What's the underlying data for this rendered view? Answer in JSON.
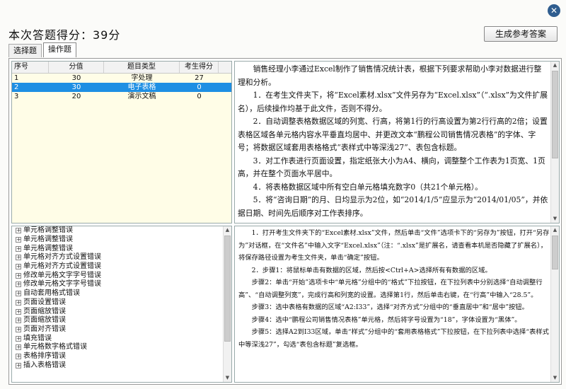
{
  "window": {
    "close_icon": "close-icon",
    "close_glyph": "✕"
  },
  "header": {
    "score_text": "本次答题得分：39分",
    "generate_button": "生成参考答案"
  },
  "tabs": [
    {
      "label": "选择题",
      "active": false
    },
    {
      "label": "操作题",
      "active": true
    }
  ],
  "table": {
    "columns": [
      "序号",
      "分值",
      "题目类型",
      "考生得分"
    ],
    "rows": [
      {
        "num": "1",
        "score": "30",
        "type": "字处理",
        "got": "27",
        "selected": false
      },
      {
        "num": "2",
        "score": "30",
        "type": "电子表格",
        "got": "0",
        "selected": true
      },
      {
        "num": "3",
        "score": "20",
        "type": "演示文稿",
        "got": "0",
        "selected": false
      }
    ]
  },
  "question": {
    "paragraphs": [
      "销售经理小李通过Excel制作了销售情况统计表，根据下列要求帮助小李对数据进行整理和分析。",
      "1．在考生文件夹下，将“Excel素材.xlsx”文件另存为“Excel.xlsx”（“.xlsx”为文件扩展名），后续操作均基于此文件，否则不得分。",
      "2．自动调整表格数据区域的列宽、行高，将第1行的行高设置为第2行行高的2倍；设置表格区域各单元格内容水平垂直均居中、并更改文本“鹏程公司销售情况表格”的字体、字号；将数据区域套用表格格式“表样式中等深浅27”、表包含标题。",
      "3．对工作表进行页面设置，指定纸张大小为A4、横向，调整整个工作表为1页宽、1页高，并在整个页面水平居中。",
      "4．将表格数据区域中所有空白单元格填充数字0（共21个单元格）。",
      "5．将“咨询日期”的月、日均显示为2位，如“2014/1/5”应显示为“2014/01/05”，并依据日期、时间先后顺序对工作表排序。"
    ]
  },
  "errors": [
    "单元格调整错误",
    "单元格调整错误",
    "单元格调整错误",
    "单元格对齐方式设置错误",
    "单元格对齐方式设置错误",
    "修改单元格文字字号错误",
    "修改单元格文字字号错误",
    "自动套用格式错误",
    "页面设置错误",
    "页面缩放错误",
    "页面缩放错误",
    "页面对齐错误",
    "填充错误",
    "单元格数字格式错误",
    "表格排序错误",
    "插入表格错误"
  ],
  "answer": {
    "paragraphs": [
      "1．打开考生文件夹下的“Excel素材.xlsx”文件，然后单击“文件”选项卡下的“另存为”按钮，打开“另存为”对话框，在“文件名”中输入文字“Excel.xlsx”（注：“.xlsx”是扩展名，请查看本机是否隐藏了扩展名），将保存路径设置为考生文件夹，单击“确定”按钮。",
      "2．步骤1：将鼠标单击有数据的区域，然后按<Ctrl+A>选择所有有数据的区域。",
      "步骤2：单击“开始”选项卡中“单元格”分组中的“格式”下拉按钮，在下拉列表中分别选择“自动调整行高”、“自动调整列宽”，完成行高和列宽的设置。选择第1行，然后单击右键，在“行高”中输入“28.5”。",
      "步骤3：选中表格有数据的区域“A2:I33”，选择“对齐方式”分组中的“垂直居中”和“居中”按钮。",
      "步骤4：选中“鹏程公司销售情况表格”单元格，然后将字号设置为“18”，字体设置为“黑体”。",
      "步骤5：选择A2到I33区域，单击“样式”分组中的“套用表格格式”下拉按钮，在下拉列表中选择“表样式中等深浅27”，勾选“表包含标题”复选框。"
    ]
  }
}
